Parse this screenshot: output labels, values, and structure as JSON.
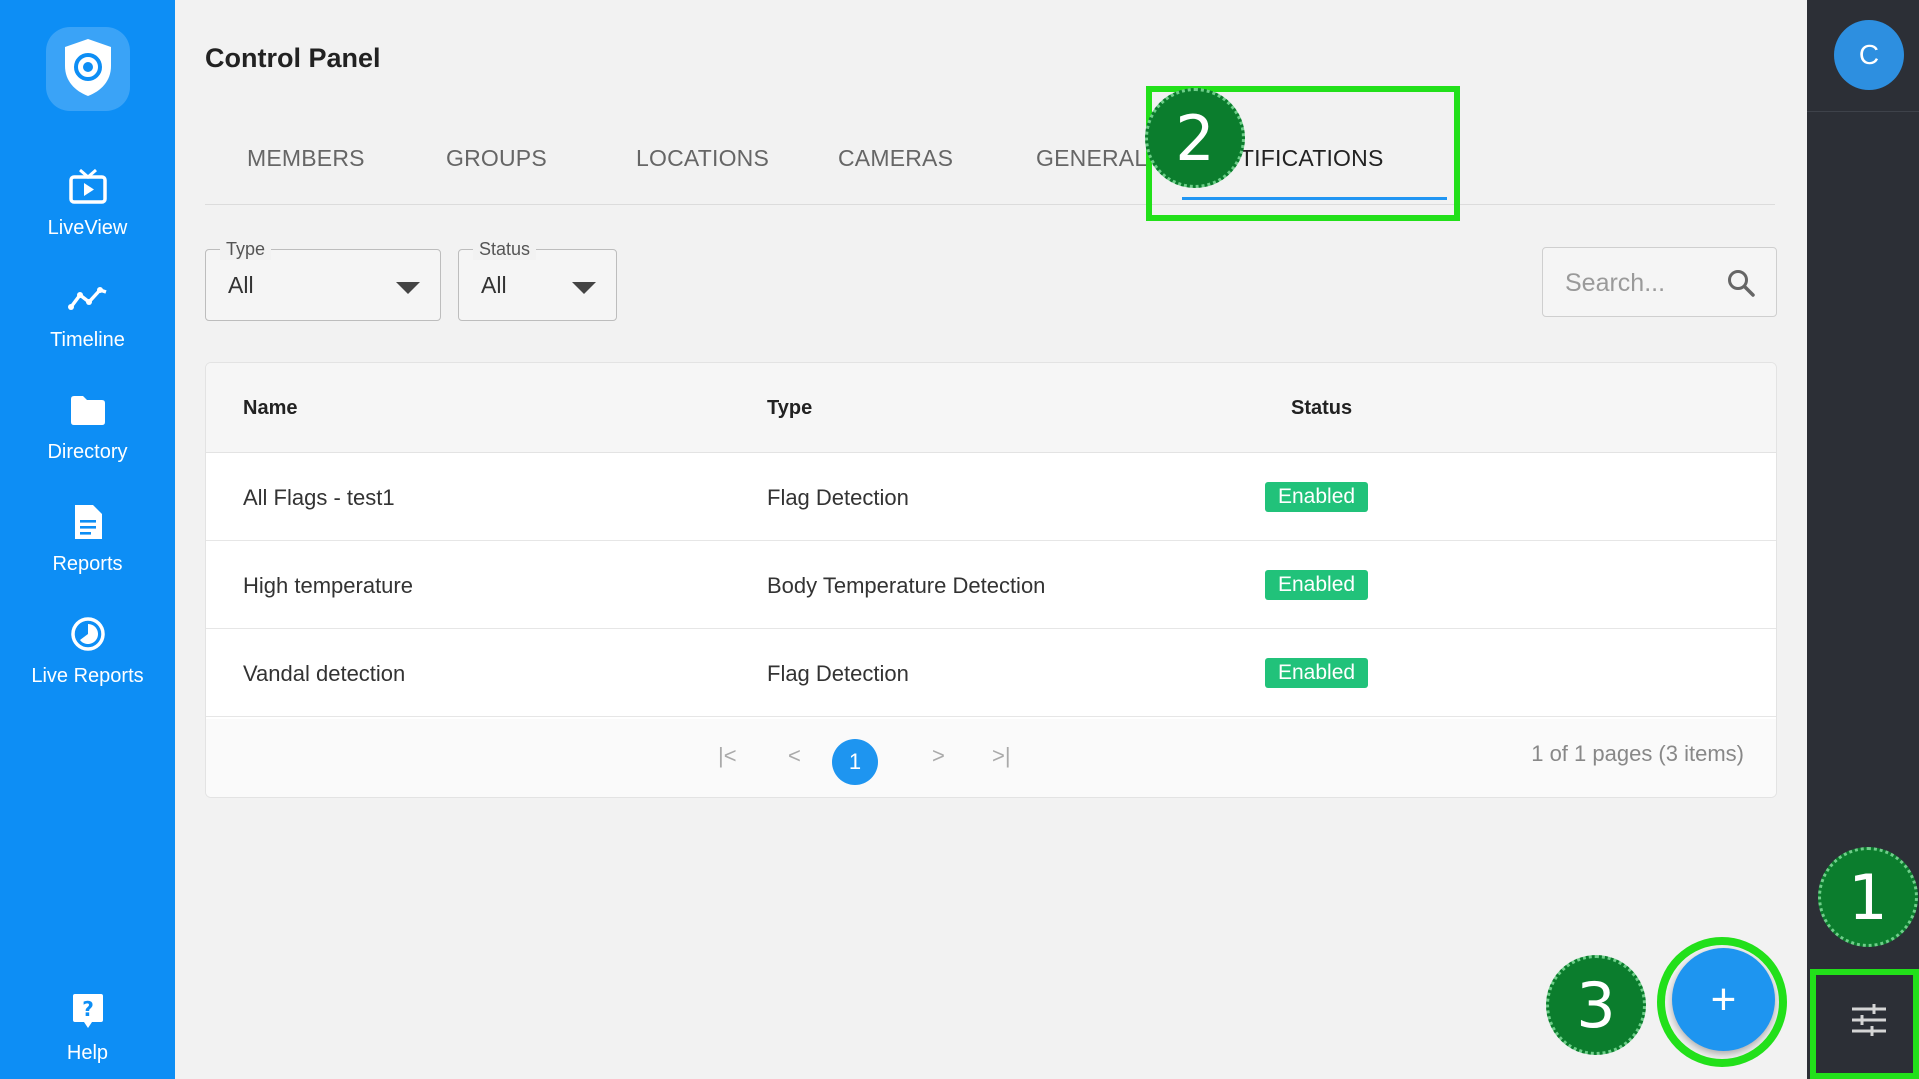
{
  "colors": {
    "sidebar": "#0d8ef5",
    "accent": "#1e95f0",
    "rail": "#2c2f36",
    "badge_enabled": "#21c27a",
    "annotation_green": "#22e01a",
    "marker_green": "#0b7d2d"
  },
  "sidebar": {
    "logo_icon": "shield-eye-icon",
    "items": [
      {
        "label": "LiveView",
        "icon": "tv-play-icon"
      },
      {
        "label": "Timeline",
        "icon": "timeline-icon"
      },
      {
        "label": "Directory",
        "icon": "folder-icon"
      },
      {
        "label": "Reports",
        "icon": "document-icon"
      },
      {
        "label": "Live Reports",
        "icon": "pie-chart-icon"
      }
    ],
    "help": {
      "label": "Help",
      "icon": "help-icon"
    }
  },
  "header": {
    "title": "Control Panel"
  },
  "tabs": [
    {
      "label": "MEMBERS",
      "active": false
    },
    {
      "label": "GROUPS",
      "active": false
    },
    {
      "label": "LOCATIONS",
      "active": false
    },
    {
      "label": "CAMERAS",
      "active": false
    },
    {
      "label": "GENERAL",
      "active": false
    },
    {
      "label": "NOTIFICATIONS",
      "active": true
    }
  ],
  "filters": {
    "type": {
      "legend": "Type",
      "value": "All"
    },
    "status": {
      "legend": "Status",
      "value": "All"
    }
  },
  "search": {
    "placeholder": "Search..."
  },
  "table": {
    "columns": [
      "Name",
      "Type",
      "Status"
    ],
    "rows": [
      {
        "name": "All Flags - test1",
        "type": "Flag Detection",
        "status": "Enabled"
      },
      {
        "name": "High temperature",
        "type": "Body Temperature Detection",
        "status": "Enabled"
      },
      {
        "name": "Vandal detection",
        "type": "Flag Detection",
        "status": "Enabled"
      }
    ]
  },
  "pagination": {
    "first": "|<",
    "prev": "<",
    "current": "1",
    "next": ">",
    "last": ">|",
    "info": "1 of 1 pages (3 items)"
  },
  "rail": {
    "avatar_initial": "C",
    "settings_icon": "sliders-icon"
  },
  "fab": {
    "label": "+"
  },
  "annotations": [
    "1",
    "2",
    "3"
  ]
}
